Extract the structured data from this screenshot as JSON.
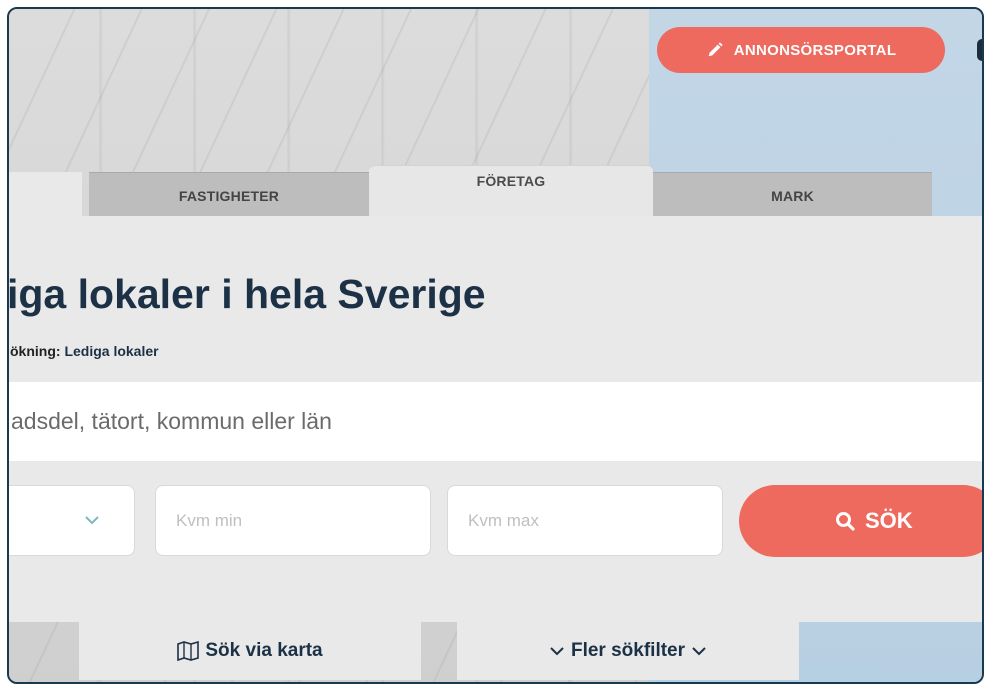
{
  "header": {
    "portal_label": "ANNONSÖRSPORTAL"
  },
  "tabs": [
    {
      "label": "FASTIGHETER",
      "active": false
    },
    {
      "label": "FÖRETAG",
      "active": true
    },
    {
      "label": "MARK",
      "active": false
    }
  ],
  "main": {
    "headline": "iga lokaler i hela Sverige",
    "subline_prefix": "ökning:",
    "subline_link": "Lediga lokaler"
  },
  "search": {
    "placeholder": "adsdel, tätort, kommun eller län",
    "kvm_min_placeholder": "Kvm min",
    "kvm_max_placeholder": "Kvm max",
    "button_label": "SÖK"
  },
  "bottom": {
    "map_label": "Sök via karta",
    "filters_label": "Fler sökfilter"
  },
  "colors": {
    "accent": "#ef6a5e",
    "navy": "#1c3146",
    "panel": "#e9e9e9"
  }
}
